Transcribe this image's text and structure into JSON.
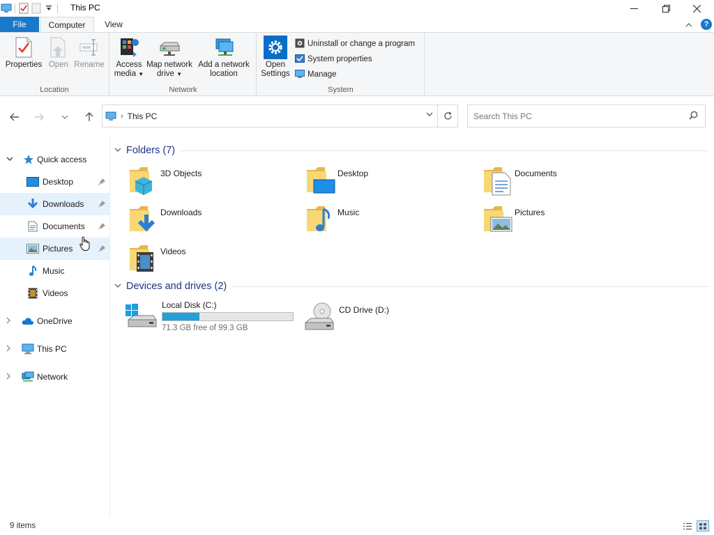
{
  "window": {
    "title": "This PC"
  },
  "ribbon": {
    "tabs": [
      {
        "label": "File"
      },
      {
        "label": "Computer"
      },
      {
        "label": "View"
      }
    ],
    "groups": {
      "location": {
        "label": "Location",
        "properties": "Properties",
        "open": "Open",
        "rename": "Rename"
      },
      "network": {
        "label": "Network",
        "access_media_1": "Access",
        "access_media_2": "media",
        "map_drive_1": "Map network",
        "map_drive_2": "drive",
        "add_location_1": "Add a network",
        "add_location_2": "location"
      },
      "system": {
        "label": "System",
        "open_settings_1": "Open",
        "open_settings_2": "Settings",
        "uninstall": "Uninstall or change a program",
        "system_properties": "System properties",
        "manage": "Manage"
      }
    },
    "help": "?"
  },
  "address": {
    "path": "This PC",
    "search_placeholder": "Search This PC"
  },
  "nav": {
    "quick_access": "Quick access",
    "desktop": "Desktop",
    "downloads": "Downloads",
    "documents": "Documents",
    "pictures": "Pictures",
    "music": "Music",
    "videos": "Videos",
    "onedrive": "OneDrive",
    "this_pc": "This PC",
    "network": "Network"
  },
  "content": {
    "folders_header": "Folders (7)",
    "folders": [
      {
        "name": "3D Objects"
      },
      {
        "name": "Desktop"
      },
      {
        "name": "Documents"
      },
      {
        "name": "Downloads"
      },
      {
        "name": "Music"
      },
      {
        "name": "Pictures"
      },
      {
        "name": "Videos"
      }
    ],
    "drives_header": "Devices and drives (2)",
    "drives": [
      {
        "name": "Local Disk (C:)",
        "free_text": "71.3 GB free of 99.3 GB",
        "used_fraction": 0.282
      },
      {
        "name": "CD Drive (D:)"
      }
    ]
  },
  "status": {
    "items": "9 items"
  },
  "colors": {
    "accent": "#1979ca",
    "usage_bar": "#26a0da",
    "section_header": "#1e3287",
    "selection": "#e5f1fb"
  }
}
